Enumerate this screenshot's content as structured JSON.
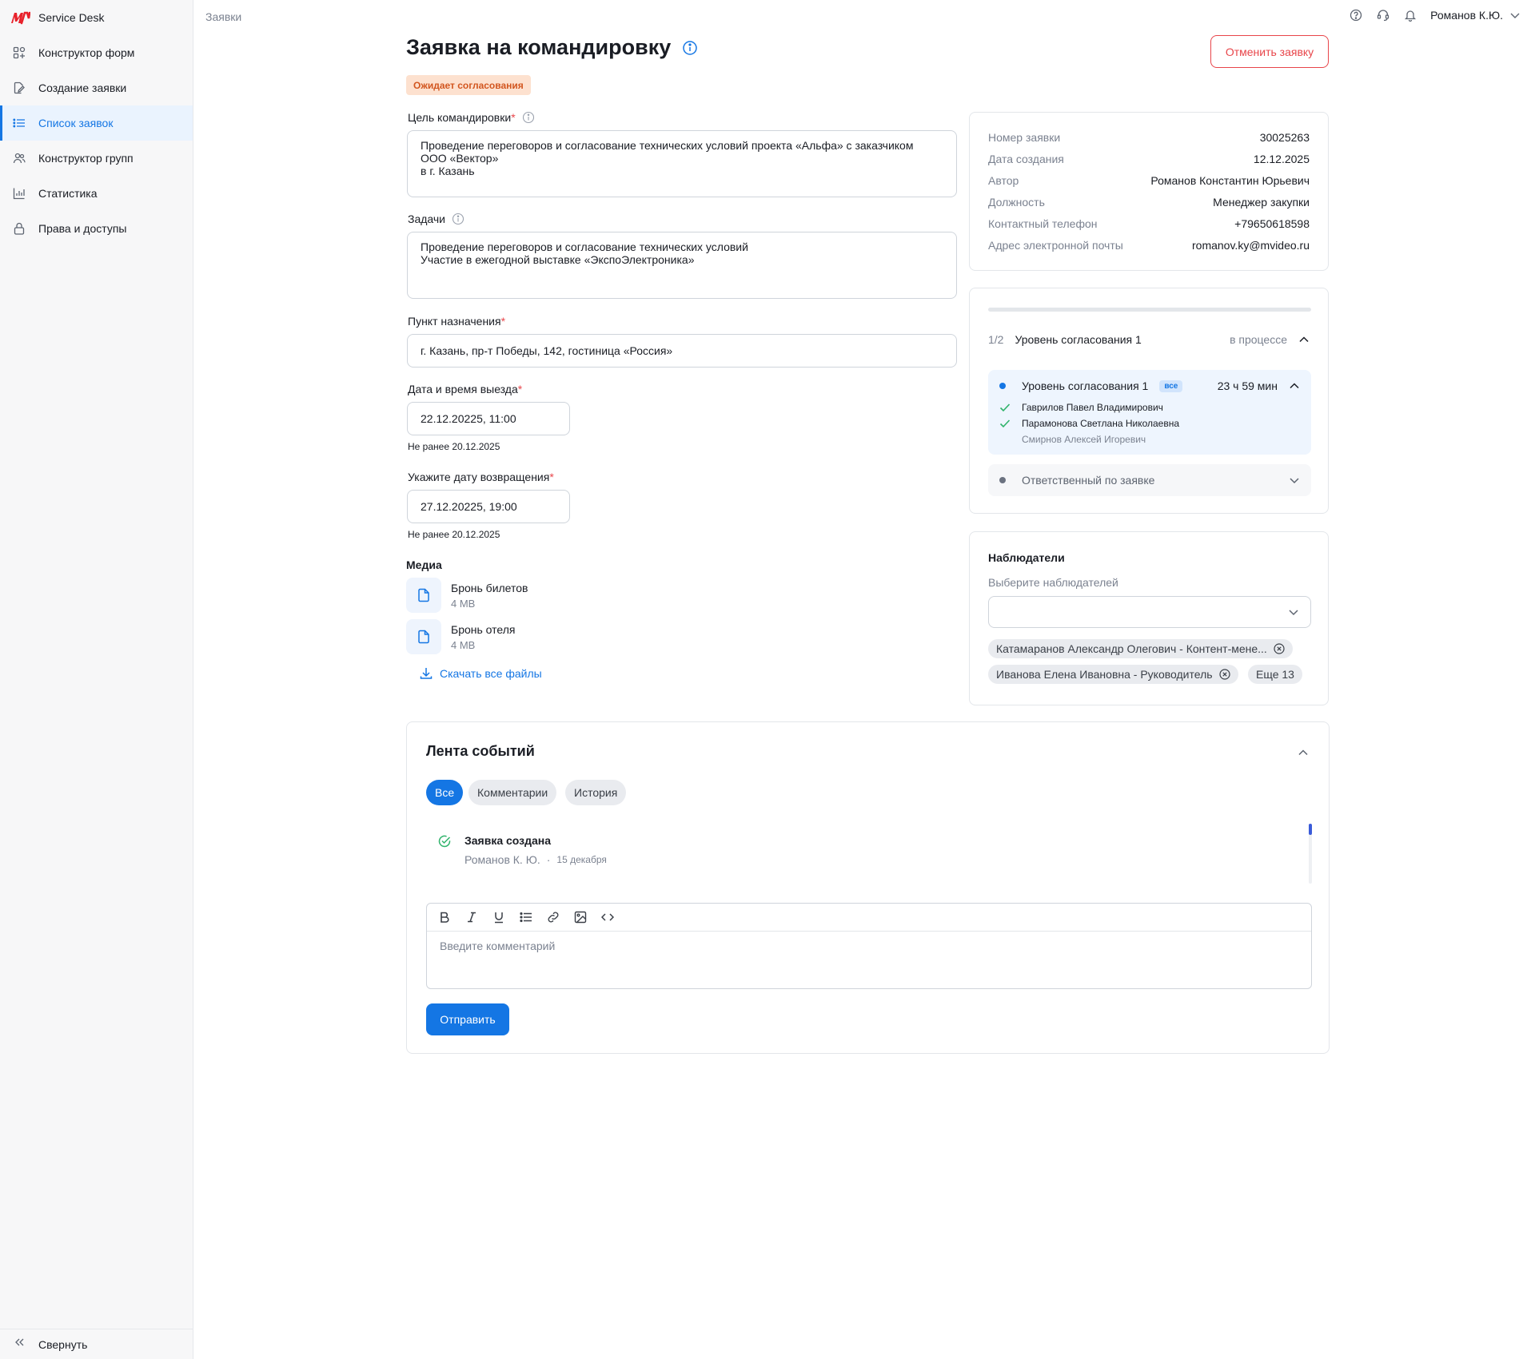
{
  "app": {
    "name": "Service Desk"
  },
  "sidebar": {
    "items": [
      {
        "label": "Конструктор форм",
        "icon": "form-builder-icon"
      },
      {
        "label": "Создание заявки",
        "icon": "edit-document-icon"
      },
      {
        "label": "Список заявок",
        "icon": "list-icon",
        "active": true
      },
      {
        "label": "Конструктор групп",
        "icon": "group-icon"
      },
      {
        "label": "Статистика",
        "icon": "chart-icon"
      },
      {
        "label": "Права и доступы",
        "icon": "lock-icon"
      }
    ],
    "collapse_label": "Свернуть"
  },
  "header": {
    "breadcrumb": "Заявки",
    "user_name": "Романов К.Ю."
  },
  "request": {
    "title": "Заявка на командировку",
    "status": "Ожидает согласования",
    "cancel_label": "Отменить заявку",
    "purpose_label": "Цель командировки",
    "purpose_value": "Проведение переговоров и согласование технических условий проекта «Альфа» с заказчиком\nООО «Вектор»\nв г. Казань",
    "tasks_label": "Задачи",
    "tasks_value": "Проведение переговоров и согласование технических условий\nУчастие в ежегодной выставке «ЭкспоЭлектроника»",
    "destination_label": "Пункт назначения",
    "destination_value": "г. Казань, пр-т Победы, 142, гостиница «Россия»",
    "departure_label": "Дата и время выезда",
    "departure_value": "22.12.20225, 11:00",
    "departure_hint": "Не ранее 20.12.2025",
    "return_label": "Укажите дату возвращения",
    "return_value": "27.12.20225, 19:00",
    "return_hint": "Не ранее 20.12.2025",
    "required_mark": "*",
    "media_title": "Медиа",
    "files": [
      {
        "name": "Бронь билетов",
        "size": "4 MB"
      },
      {
        "name": "Бронь отеля",
        "size": "4 MB"
      }
    ],
    "download_all": "Скачать все файлы"
  },
  "details": {
    "rows": [
      {
        "k": "Номер заявки",
        "v": "30025263"
      },
      {
        "k": "Дата создания",
        "v": "12.12.2025"
      },
      {
        "k": "Автор",
        "v": "Романов Константин Юрьевич"
      },
      {
        "k": "Должность",
        "v": "Менеджер закупки"
      },
      {
        "k": "Контактный телефон",
        "v": "+79650618598"
      },
      {
        "k": "Адрес электронной почты",
        "v": "romanov.ky@mvideo.ru"
      }
    ]
  },
  "approval": {
    "fraction": "1/2",
    "title": "Уровень согласования 1",
    "state": "в процессе",
    "progress": 0,
    "level": {
      "title": "Уровень согласования 1",
      "tag": "все",
      "time_left": "23 ч 59 мин",
      "people": [
        {
          "name": "Гаврилов Павел Владимирович",
          "approved": true
        },
        {
          "name": "Парамонова Светлана Николаевна",
          "approved": true
        },
        {
          "name": "Смирнов Алексей Игоревич",
          "approved": false
        }
      ]
    },
    "responsible": "Ответственный по заявке"
  },
  "observers": {
    "title": "Наблюдатели",
    "select_label": "Выберите наблюдателей",
    "chips": [
      "Катамаранов Александр Олегович - Контент-мене...",
      "Иванова Елена Ивановна - Руководитель"
    ],
    "more": "Еще 13"
  },
  "feed": {
    "title": "Лента событий",
    "tabs": [
      "Все",
      "Комментарии",
      "История"
    ],
    "events": [
      {
        "title": "Заявка создана",
        "author": "Романов К. Ю.",
        "date": "15 декабря"
      }
    ],
    "comment_placeholder": "Введите комментарий",
    "send_label": "Отправить"
  },
  "colors": {
    "accent": "#1476e4",
    "danger": "#e8454a",
    "success": "#2fb36b",
    "status_bg": "#fde1cf",
    "status_fg": "#d2561f"
  }
}
